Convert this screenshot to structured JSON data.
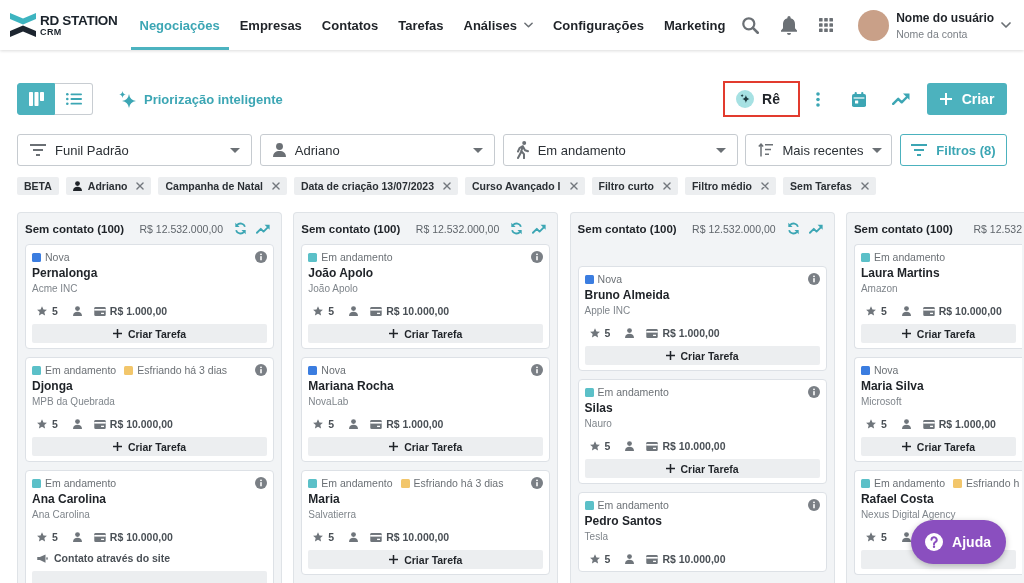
{
  "header": {
    "brand": {
      "name": "RD STATION",
      "product": "CRM"
    },
    "nav": [
      {
        "label": "Negociações",
        "selected": true,
        "dropdown": false
      },
      {
        "label": "Empresas",
        "selected": false,
        "dropdown": false
      },
      {
        "label": "Contatos",
        "selected": false,
        "dropdown": false
      },
      {
        "label": "Tarefas",
        "selected": false,
        "dropdown": false
      },
      {
        "label": "Análises",
        "selected": false,
        "dropdown": true
      },
      {
        "label": "Configurações",
        "selected": false,
        "dropdown": false
      },
      {
        "label": "Marketing",
        "selected": false,
        "dropdown": false
      }
    ],
    "user": {
      "name": "Nome do usuário",
      "account": "Nome da conta"
    }
  },
  "toolbar": {
    "views": [
      {
        "kind": "board",
        "selected": true
      },
      {
        "kind": "list",
        "selected": false
      }
    ],
    "smart_priority": "Priorização inteligente",
    "assistant": {
      "label": "Rê",
      "highlighted": true
    },
    "create_button": "Criar"
  },
  "filters": [
    {
      "kind": "funnel",
      "value": "Funil Padrão"
    },
    {
      "kind": "owner",
      "value": "Adriano"
    },
    {
      "kind": "status",
      "value": "Em andamento"
    },
    {
      "kind": "sort",
      "value": "Mais recentes"
    }
  ],
  "filters_button": "Filtros (8)",
  "chips": [
    {
      "kind": "badge",
      "label": "BETA"
    },
    {
      "kind": "person",
      "label": "Adriano"
    },
    {
      "kind": "filter",
      "label": "Campanha de Natal"
    },
    {
      "kind": "filter",
      "label": "Data de criação 13/07/2023"
    },
    {
      "kind": "filter",
      "label": "Curso Avançado I"
    },
    {
      "kind": "filter",
      "label": "Filtro curto"
    },
    {
      "kind": "filter",
      "label": "Filtro médio"
    },
    {
      "kind": "filter",
      "label": "Sem Tarefas"
    }
  ],
  "columns": [
    {
      "title": "Sem contato (100)",
      "total": "R$ 12.532.000,00",
      "header_icons": true,
      "cards": [
        {
          "tags": [
            {
              "label": "Nova",
              "color": "#3b7de0"
            }
          ],
          "name": "Pernalonga",
          "company": "Acme INC",
          "rating": "5",
          "value": "R$ 1.000,00",
          "task_button": true,
          "task_label": "Criar Tarefa"
        },
        {
          "tags": [
            {
              "label": "Em andamento",
              "color": "#5bc0c8"
            },
            {
              "label": "Esfriando há 3 dias",
              "color": "#f2c66b"
            }
          ],
          "name": "Djonga",
          "company": "MPB da Quebrada",
          "rating": "5",
          "value": "R$ 10.000,00",
          "task_button": true,
          "task_label": "Criar Tarefa"
        },
        {
          "tags": [
            {
              "label": "Em andamento",
              "color": "#5bc0c8"
            }
          ],
          "name": "Ana Carolina",
          "company": "Ana Carolina",
          "rating": "5",
          "value": "R$ 10.000,00",
          "source": "Contato através do site",
          "task_button": true
        }
      ]
    },
    {
      "title": "Sem contato (100)",
      "total": "R$ 12.532.000,00",
      "header_icons": true,
      "cards": [
        {
          "tags": [
            {
              "label": "Em andamento",
              "color": "#5bc0c8"
            }
          ],
          "name": "João Apolo",
          "company": "João Apolo",
          "rating": "5",
          "value": "R$ 10.000,00",
          "task_button": true,
          "task_label": "Criar Tarefa"
        },
        {
          "tags": [
            {
              "label": "Nova",
              "color": "#3b7de0"
            }
          ],
          "name": "Mariana Rocha",
          "company": "NovaLab",
          "rating": "5",
          "value": "R$ 1.000,00",
          "task_button": true,
          "task_label": "Criar Tarefa"
        },
        {
          "tags": [
            {
              "label": "Em andamento",
              "color": "#5bc0c8"
            },
            {
              "label": "Esfriando há 3 dias",
              "color": "#f2c66b"
            }
          ],
          "name": "Maria",
          "company": "Salvatierra",
          "rating": "5",
          "value": "R$ 10.000,00",
          "task_button": true,
          "task_label": "Criar Tarefa"
        }
      ]
    },
    {
      "title": "Sem contato (100)",
      "total": "R$ 12.532.000,00",
      "header_icons": true,
      "cards": [
        {
          "tags": [
            {
              "label": "Nova",
              "color": "#3b7de0"
            }
          ],
          "name": "Bruno Almeida",
          "company": "Apple INC",
          "rating": "5",
          "value": "R$ 1.000,00",
          "task_button": true,
          "task_label": "Criar Tarefa"
        },
        {
          "tags": [
            {
              "label": "Em andamento",
              "color": "#5bc0c8"
            }
          ],
          "name": "Silas",
          "company": "Nauro",
          "rating": "5",
          "value": "R$ 10.000,00",
          "task_button": true,
          "task_label": "Criar Tarefa"
        },
        {
          "tags": [
            {
              "label": "Em andamento",
              "color": "#5bc0c8"
            }
          ],
          "name": "Pedro Santos",
          "company": "Tesla",
          "rating": "5",
          "value": "R$ 10.000,00",
          "task_button": false
        }
      ]
    },
    {
      "title": "Sem contato (100)",
      "total": "R$ 12.532",
      "header_icons": false,
      "cards": [
        {
          "tags": [
            {
              "label": "Em andamento",
              "color": "#5bc0c8"
            }
          ],
          "name": "Laura Martins",
          "company": "Amazon",
          "rating": "5",
          "value": "R$ 10.000,00",
          "task_button": true,
          "task_label": "Criar Tarefa"
        },
        {
          "tags": [
            {
              "label": "Nova",
              "color": "#3b7de0"
            }
          ],
          "name": "Maria Silva",
          "company": "Microsoft",
          "rating": "5",
          "value": "R$ 1.000,00",
          "task_button": true,
          "task_label": "Criar Tarefa"
        },
        {
          "tags": [
            {
              "label": "Em andamento",
              "color": "#5bc0c8"
            },
            {
              "label": "Esfriando h",
              "color": "#f2c66b"
            }
          ],
          "name": "Rafael Costa",
          "company": "Nexus Digital Agency",
          "rating": "5",
          "task_button": true
        }
      ]
    }
  ],
  "help_button": "Ajuda"
}
